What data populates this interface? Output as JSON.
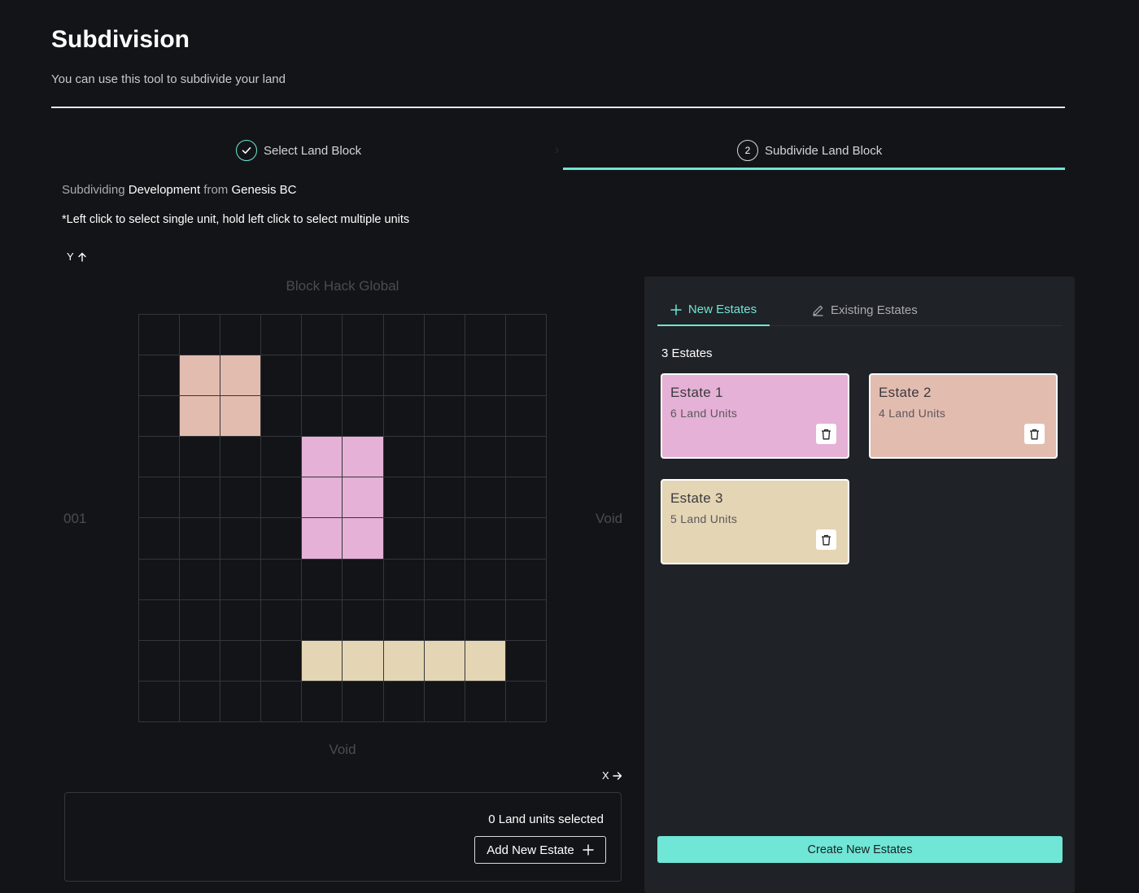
{
  "header": {
    "title": "Subdivision",
    "subtitle": "You can use this tool to subdivide your land"
  },
  "stepper": {
    "steps": [
      {
        "label": "Select Land Block",
        "state": "completed",
        "icon": "check-icon"
      },
      {
        "label": "Subdivide Land Block",
        "state": "active",
        "number": "2"
      }
    ]
  },
  "context": {
    "prefix": "Subdividing",
    "development": "Development",
    "from": "from",
    "block": "Genesis BC",
    "hint": "*Left click to select single unit, hold left click to select multiple units"
  },
  "grid": {
    "y_axis": "Y",
    "x_axis": "X",
    "top_label": "Block Hack Global",
    "left_label": "001",
    "right_label": "Void",
    "bottom_label": "Void",
    "size": 10,
    "empty_color": "#131417",
    "assignments": [
      {
        "estate": 2,
        "cells": [
          [
            1,
            1
          ],
          [
            1,
            2
          ],
          [
            2,
            1
          ],
          [
            2,
            2
          ]
        ]
      },
      {
        "estate": 1,
        "cells": [
          [
            3,
            4
          ],
          [
            3,
            5
          ],
          [
            4,
            4
          ],
          [
            4,
            5
          ],
          [
            5,
            4
          ],
          [
            5,
            5
          ]
        ]
      },
      {
        "estate": 3,
        "cells": [
          [
            8,
            4
          ],
          [
            8,
            5
          ],
          [
            8,
            6
          ],
          [
            8,
            7
          ],
          [
            8,
            8
          ]
        ]
      }
    ]
  },
  "selection": {
    "count_text": "0 Land units selected",
    "add_button": "Add New Estate",
    "add_icon": "plus-icon"
  },
  "panel": {
    "tabs": [
      {
        "label": "New Estates",
        "icon": "plus-icon",
        "active": true
      },
      {
        "label": "Existing Estates",
        "icon": "pencil-icon",
        "active": false
      }
    ],
    "estates_count": "3 Estates",
    "estates": [
      {
        "id": 1,
        "name": "Estate 1",
        "units": "6 Land Units",
        "color": "#e5b1d6"
      },
      {
        "id": 2,
        "name": "Estate 2",
        "units": "4 Land Units",
        "color": "#e3bcb0"
      },
      {
        "id": 3,
        "name": "Estate 3",
        "units": "5 Land Units",
        "color": "#e4d5b4"
      }
    ],
    "create_button": "Create New Estates"
  },
  "colors": {
    "accent": "#6fe6d6",
    "background": "#131417",
    "panel": "#1f2226"
  }
}
